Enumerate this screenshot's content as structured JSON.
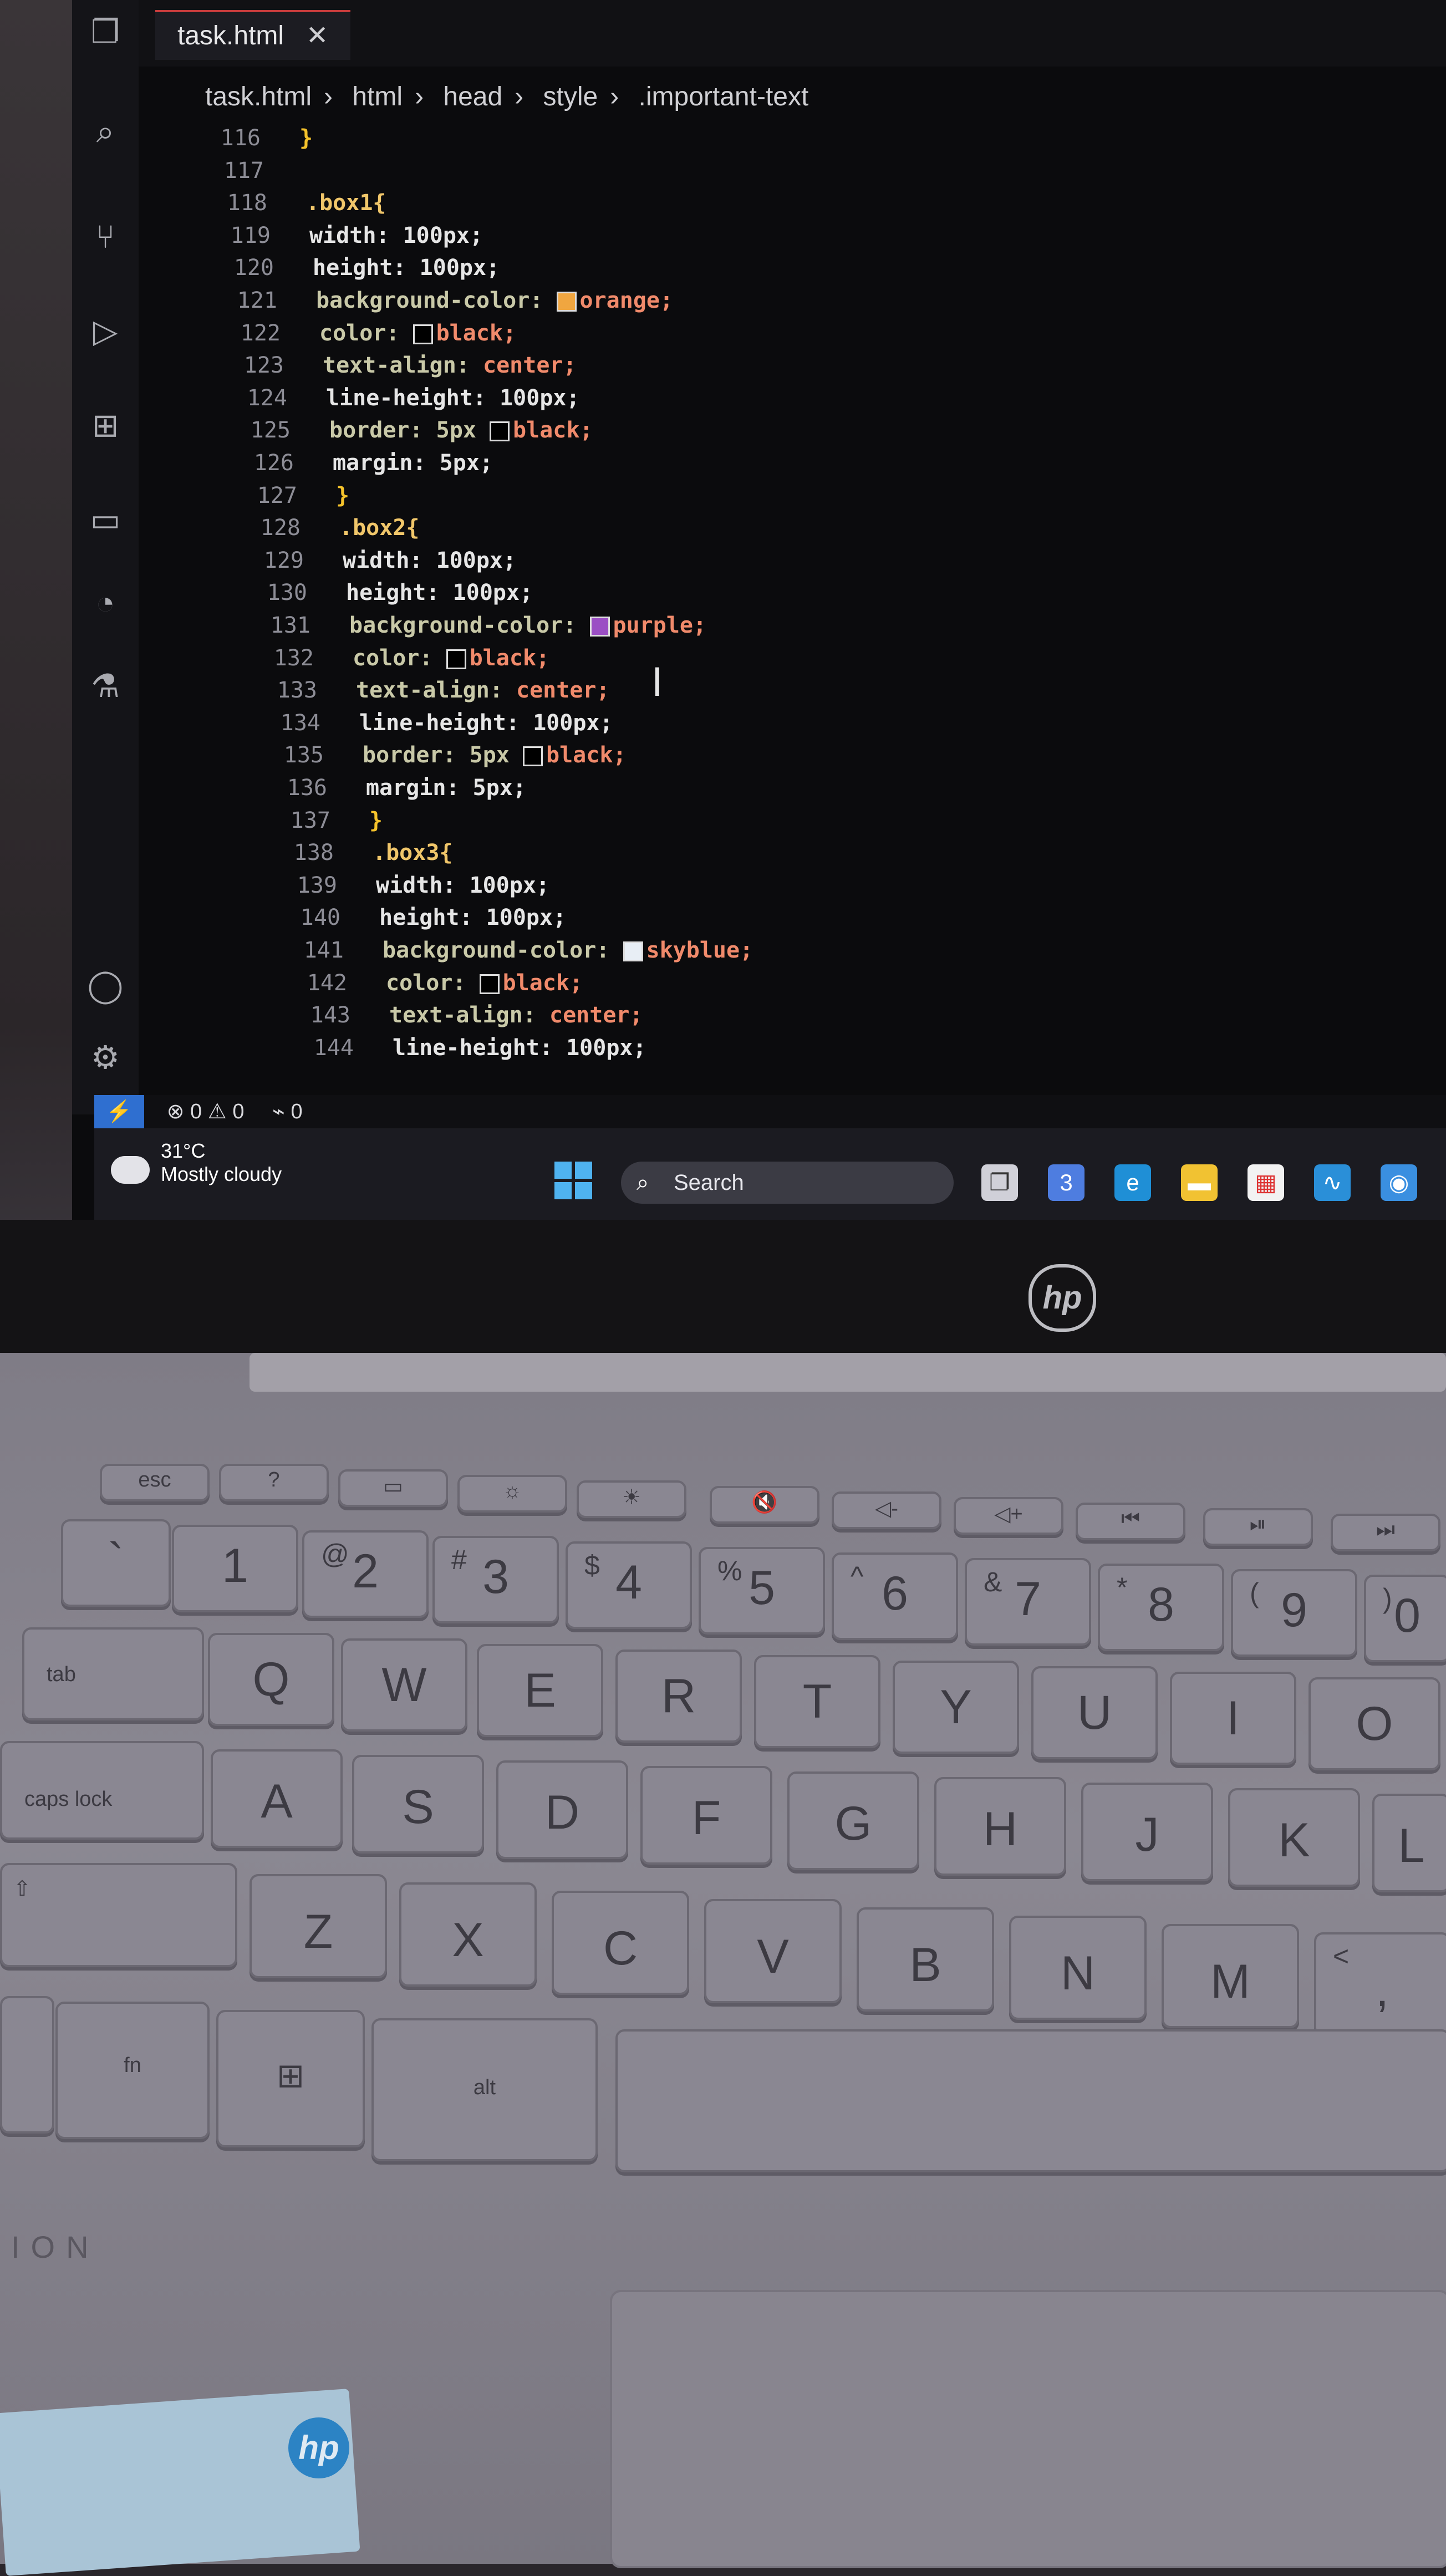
{
  "editor_tab": {
    "file": "task.html",
    "close": "✕"
  },
  "breadcrumb": [
    "task.html",
    "html",
    "head",
    "style",
    ".important-text"
  ],
  "code_lines": [
    {
      "n": "116",
      "text": "}",
      "kind": "brace",
      "indent": 0
    },
    {
      "n": "117",
      "text": "",
      "kind": "blank",
      "indent": 0
    },
    {
      "n": "118",
      "text": ".box1{",
      "kind": "sel",
      "indent": 0
    },
    {
      "n": "119",
      "text": "width: 100px;",
      "kind": "prop",
      "indent": 0
    },
    {
      "n": "120",
      "text": "height: 100px;",
      "kind": "prop",
      "indent": 0
    },
    {
      "n": "121",
      "prop": "background-color:",
      "swatch": "#f0a640",
      "value": "orange;",
      "kind": "swatch",
      "indent": 0
    },
    {
      "n": "122",
      "prop": "color:",
      "swatch": "#000000",
      "value": "black;",
      "kind": "swatch",
      "indent": 0
    },
    {
      "n": "123",
      "prop": "text-align:",
      "value": "center;",
      "kind": "pv",
      "indent": 0
    },
    {
      "n": "124",
      "text": "line-height: 100px;",
      "kind": "prop",
      "indent": 0
    },
    {
      "n": "125",
      "prop": "border: 5px",
      "swatch": "#000000",
      "value": "black;",
      "kind": "swatch",
      "indent": 0
    },
    {
      "n": "126",
      "text": "margin: 5px;",
      "kind": "prop",
      "indent": 0
    },
    {
      "n": "127",
      "text": "}",
      "kind": "brace",
      "indent": 0
    },
    {
      "n": "128",
      "text": ".box2{",
      "kind": "sel",
      "indent": 0
    },
    {
      "n": "129",
      "text": "width: 100px;",
      "kind": "prop",
      "indent": 0
    },
    {
      "n": "130",
      "text": "height: 100px;",
      "kind": "prop",
      "indent": 0
    },
    {
      "n": "131",
      "prop": "background-color:",
      "swatch": "#9b4fc4",
      "value": "purple;",
      "kind": "swatch",
      "indent": 0
    },
    {
      "n": "132",
      "prop": "color:",
      "swatch": "#000000",
      "value": "black;",
      "kind": "swatch",
      "indent": 0
    },
    {
      "n": "133",
      "prop": "text-align:",
      "value": "center;",
      "kind": "pv",
      "indent": 0
    },
    {
      "n": "134",
      "text": "line-height: 100px;",
      "kind": "prop",
      "indent": 0
    },
    {
      "n": "135",
      "prop": "border: 5px",
      "swatch": "#000000",
      "value": "black;",
      "kind": "swatch",
      "indent": 0
    },
    {
      "n": "136",
      "text": "margin: 5px;",
      "kind": "prop",
      "indent": 0
    },
    {
      "n": "137",
      "text": "}",
      "kind": "brace",
      "indent": 0
    },
    {
      "n": "138",
      "text": ".box3{",
      "kind": "sel",
      "indent": 0
    },
    {
      "n": "139",
      "text": "width: 100px;",
      "kind": "prop",
      "indent": 0
    },
    {
      "n": "140",
      "text": "height: 100px;",
      "kind": "prop",
      "indent": 0
    },
    {
      "n": "141",
      "prop": "background-color:",
      "swatch": "#e8eef5",
      "value": "skyblue;",
      "kind": "swatch",
      "indent": 0
    },
    {
      "n": "142",
      "prop": "color:",
      "swatch": "#000000",
      "value": "black;",
      "kind": "swatch",
      "indent": 0
    },
    {
      "n": "143",
      "prop": "text-align:",
      "value": "center;",
      "kind": "pv",
      "indent": 0
    },
    {
      "n": "144",
      "text": "line-height: 100px;",
      "kind": "prop",
      "indent": 0
    }
  ],
  "status": {
    "errors": "0",
    "warnings": "0",
    "ports": "0"
  },
  "taskbar": {
    "temp": "31°C",
    "weather": "Mostly cloudy",
    "search": "Search",
    "chat_badge": "3"
  },
  "laptop": {
    "logo": "hp",
    "keys_row1": [
      "esc"
    ],
    "alt": "alt",
    "fn": "fn",
    "tab": "tab",
    "caps": "caps lock"
  }
}
